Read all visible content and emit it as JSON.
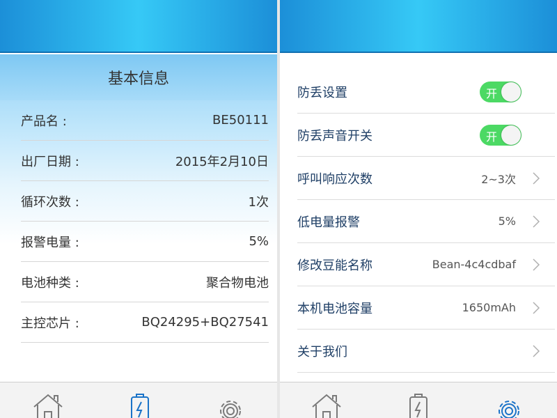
{
  "left_panel": {
    "title": "基本信息",
    "rows": [
      {
        "label": "产品名 :",
        "value": "BE50111"
      },
      {
        "label": "出厂日期 :",
        "value": "2015年2月10日"
      },
      {
        "label": "循环次数 :",
        "value": "1次"
      },
      {
        "label": "报警电量 :",
        "value": "5%"
      },
      {
        "label": "电池种类 :",
        "value": "聚合物电池"
      },
      {
        "label": "主控芯片 :",
        "value": "BQ24295+BQ27541"
      }
    ],
    "active_tab": "battery"
  },
  "right_panel": {
    "settings": [
      {
        "label": "防丢设置",
        "toggle": "开"
      },
      {
        "label": "防丢声音开关",
        "toggle": "开"
      },
      {
        "label": "呼叫响应次数",
        "value": "2~3次"
      },
      {
        "label": "低电量报警",
        "value": "5%"
      },
      {
        "label": "修改豆能名称",
        "value": "Bean-4c4cdbaf"
      },
      {
        "label": "本机电池容量",
        "value": "1650mAh"
      },
      {
        "label": "关于我们",
        "value": ""
      }
    ],
    "active_tab": "settings"
  },
  "nav_icons": [
    "home-icon",
    "battery-icon",
    "gear-icon"
  ],
  "colors": {
    "header_blue": "#36c9f6",
    "toggle_on": "#4cd964",
    "nav_active": "#1a73c8",
    "nav_inactive": "#7a7a7a"
  }
}
